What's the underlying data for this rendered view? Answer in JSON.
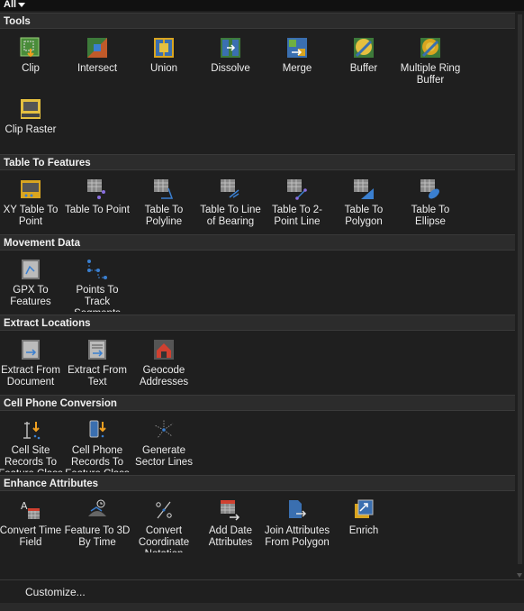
{
  "filter": {
    "label": "All"
  },
  "sections": [
    {
      "title": "Tools",
      "tools": [
        {
          "label": "Clip",
          "icon": "clip-icon"
        },
        {
          "label": "Intersect",
          "icon": "intersect-icon"
        },
        {
          "label": "Union",
          "icon": "union-icon"
        },
        {
          "label": "Dissolve",
          "icon": "dissolve-icon"
        },
        {
          "label": "Merge",
          "icon": "merge-icon"
        },
        {
          "label": "Buffer",
          "icon": "buffer-icon"
        },
        {
          "label": "Multiple Ring Buffer",
          "icon": "multiple-ring-buffer-icon"
        },
        {
          "label": "Clip Raster",
          "icon": "clip-raster-icon"
        }
      ]
    },
    {
      "title": "Table To Features",
      "tools": [
        {
          "label": "XY Table To Point",
          "icon": "xy-table-to-point-icon"
        },
        {
          "label": "Table To Point",
          "icon": "table-to-point-icon"
        },
        {
          "label": "Table To Polyline",
          "icon": "table-to-polyline-icon"
        },
        {
          "label": "Table To Line of Bearing",
          "icon": "table-to-line-of-bearing-icon"
        },
        {
          "label": "Table To 2-Point Line",
          "icon": "table-to-2-point-line-icon"
        },
        {
          "label": "Table To Polygon",
          "icon": "table-to-polygon-icon"
        },
        {
          "label": "Table To Ellipse",
          "icon": "table-to-ellipse-icon"
        }
      ]
    },
    {
      "title": "Movement Data",
      "tools": [
        {
          "label": "GPX To Features",
          "icon": "gpx-to-features-icon"
        },
        {
          "label": "Points To Track Segments",
          "icon": "points-to-track-icon"
        }
      ]
    },
    {
      "title": "Extract Locations",
      "tools": [
        {
          "label": "Extract From Document",
          "icon": "extract-from-document-icon"
        },
        {
          "label": "Extract From Text",
          "icon": "extract-from-text-icon"
        },
        {
          "label": "Geocode Addresses",
          "icon": "geocode-addresses-icon"
        }
      ]
    },
    {
      "title": "Cell Phone Conversion",
      "tools": [
        {
          "label": "Cell Site Records To Feature Class",
          "icon": "cell-site-records-icon"
        },
        {
          "label": "Cell Phone Records To Feature Class",
          "icon": "cell-phone-records-icon"
        },
        {
          "label": "Generate Sector Lines",
          "icon": "generate-sector-lines-icon"
        }
      ]
    },
    {
      "title": "Enhance Attributes",
      "tools": [
        {
          "label": "Convert Time Field",
          "icon": "convert-time-field-icon"
        },
        {
          "label": "Feature To 3D By Time",
          "icon": "feature-to-3d-by-time-icon"
        },
        {
          "label": "Convert Coordinate Notation",
          "icon": "convert-coordinate-notation-icon"
        },
        {
          "label": "Add Date Attributes",
          "icon": "add-date-attributes-icon"
        },
        {
          "label": "Join Attributes From Polygon",
          "icon": "join-attributes-icon"
        },
        {
          "label": "Enrich",
          "icon": "enrich-icon"
        }
      ]
    }
  ],
  "footer": {
    "customize": "Customize..."
  }
}
